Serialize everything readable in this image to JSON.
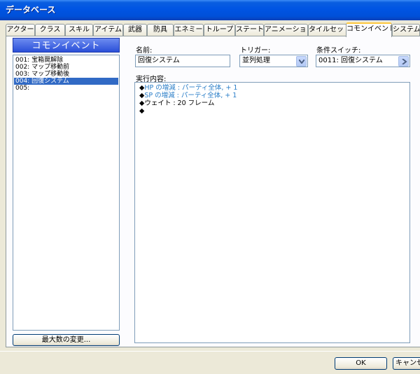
{
  "window": {
    "title": "データベース"
  },
  "tabs": [
    {
      "label": "アクター"
    },
    {
      "label": "クラス"
    },
    {
      "label": "スキル"
    },
    {
      "label": "アイテム"
    },
    {
      "label": "武器"
    },
    {
      "label": "防具"
    },
    {
      "label": "エネミー"
    },
    {
      "label": "トループ"
    },
    {
      "label": "ステート"
    },
    {
      "label": "アニメーション"
    },
    {
      "label": "タイルセット"
    },
    {
      "label": "コモンイベント"
    },
    {
      "label": "システム"
    }
  ],
  "active_tab": "コモンイベント",
  "list": {
    "header": "コモンイベント",
    "items": [
      "001: 宝箱罠解除",
      "002: マップ移動前",
      "003: マップ移動後",
      "004: 回復システム",
      "005:"
    ],
    "selected_index": 3,
    "max_button": "最大数の変更..."
  },
  "form": {
    "name_label": "名前:",
    "name_value": "回復システム",
    "trigger_label": "トリガー:",
    "trigger_value": "並列処理",
    "switch_label": "条件スイッチ:",
    "switch_value": "0011: 回復システム",
    "content_label": "実行内容:"
  },
  "commands": [
    {
      "marker": "◆",
      "text": "HP の増減 : パーティ全体, + 1",
      "color": "#2a7ec8"
    },
    {
      "marker": "◆",
      "text": "SP の増減 : パーティ全体, + 1",
      "color": "#2a7ec8"
    },
    {
      "marker": "◆",
      "text": "ウェイト : 20 フレーム",
      "color": "#000000"
    },
    {
      "marker": "◆",
      "text": "",
      "color": "#000000"
    }
  ],
  "footer": {
    "ok_label": "OK",
    "cancel_label": "キャンセル"
  },
  "colors": {
    "selection": "#316ac5",
    "command_blue": "#2a7ec8",
    "titlebar": "#0054e3"
  }
}
